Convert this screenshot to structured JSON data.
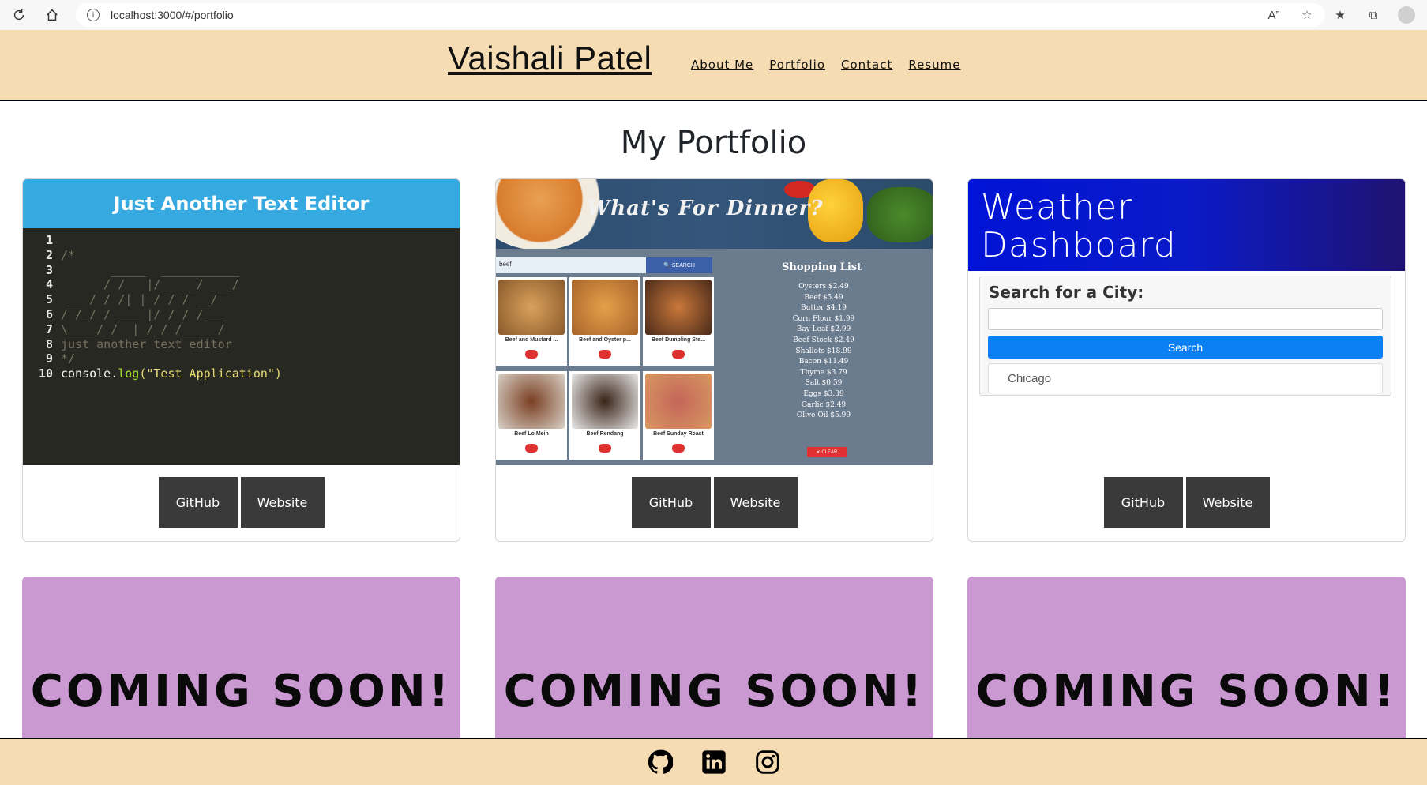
{
  "browser": {
    "url": "localhost:3000/#/portfolio"
  },
  "header": {
    "title": "Vaishali Patel",
    "nav": [
      "About Me",
      "Portfolio",
      "Contact",
      "Resume"
    ]
  },
  "main": {
    "title": "My Portfolio",
    "projects": [
      {
        "name": "Just Another Text Editor",
        "github_label": "GitHub",
        "website_label": "Website",
        "code_lines": [
          {
            "n": "1",
            "t": ""
          },
          {
            "n": "2",
            "t": "/*"
          },
          {
            "n": "3",
            "t": "       _____  ___________"
          },
          {
            "n": "4",
            "t": "      / /   |/_  __/ ___/"
          },
          {
            "n": "5",
            "t": " __ / / /| | / / / __/"
          },
          {
            "n": "6",
            "t": "/ /_/ / ___ |/ / / /___"
          },
          {
            "n": "7",
            "t": "\\____/_/  |_/_/ /_____/"
          },
          {
            "n": "8",
            "t": "just another text editor"
          },
          {
            "n": "9",
            "t": "*/"
          }
        ],
        "code_last": {
          "n": "10",
          "pre": "console.",
          "fn": "log",
          "str": "(\"Test Application\")"
        }
      },
      {
        "name": "What's For Dinner?",
        "github_label": "GitHub",
        "website_label": "Website",
        "search_value": "beef",
        "search_button": "SEARCH",
        "foods": [
          "Beef and Mustard ...",
          "Beef and Oyster p...",
          "Beef Dumpling Ste...",
          "Beef Lo Mein",
          "Beef Rendang",
          "Beef Sunday Roast"
        ],
        "shopping_title": "Shopping List",
        "shopping_items": [
          "Oysters $2.49",
          "Beef $5.49",
          "Butter $4.19",
          "Corn Flour $1.99",
          "Bay Leaf $2.99",
          "Beef Stock $2.49",
          "Shallots $18.99",
          "Bacon $11.49",
          "Thyme $3.79",
          "Salt $0.59",
          "Eggs $3.39",
          "Garlic $2.49",
          "Olive Oil $5.99"
        ],
        "clear_label": "✕ CLEAR"
      },
      {
        "name_line1": "Weather",
        "name_line2": "Dashboard",
        "search_label": "Search for a City:",
        "search_button": "Search",
        "city": "Chicago",
        "github_label": "GitHub",
        "website_label": "Website"
      }
    ],
    "coming_soon": [
      "COMING SOON!",
      "COMING SOON!",
      "COMING SOON!"
    ]
  },
  "footer": {
    "icons": [
      "github-icon",
      "linkedin-icon",
      "instagram-icon"
    ]
  },
  "colors": {
    "header_bg": "#f6dcb3",
    "button_bg": "#3a3a3a",
    "coming_soon_bg": "#ca99d2"
  }
}
